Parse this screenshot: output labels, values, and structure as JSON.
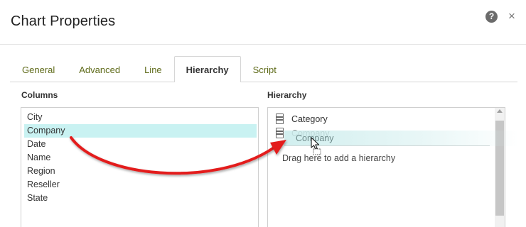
{
  "dialog": {
    "title": "Chart Properties",
    "help_icon": "question-circle-icon",
    "help_glyph": "?",
    "close_icon": "close-icon",
    "close_glyph": "×"
  },
  "tabs": [
    {
      "label": "General",
      "active": false
    },
    {
      "label": "Advanced",
      "active": false
    },
    {
      "label": "Line",
      "active": false
    },
    {
      "label": "Hierarchy",
      "active": true
    },
    {
      "label": "Script",
      "active": false
    }
  ],
  "columns": {
    "label": "Columns",
    "items": [
      "City",
      "Company",
      "Date",
      "Name",
      "Region",
      "Reseller",
      "State"
    ],
    "selected": "Company"
  },
  "hierarchy": {
    "label": "Hierarchy",
    "items": [
      "Category",
      "Company"
    ],
    "item_icon": "hierarchy-level-icon",
    "drag_ghost": "Company",
    "drop_hint": "Drag here to add a hierarchy"
  },
  "colors": {
    "tab_text": "#5f6b1a",
    "selection": "#c9f2f2",
    "arrow": "#e31b1b"
  }
}
